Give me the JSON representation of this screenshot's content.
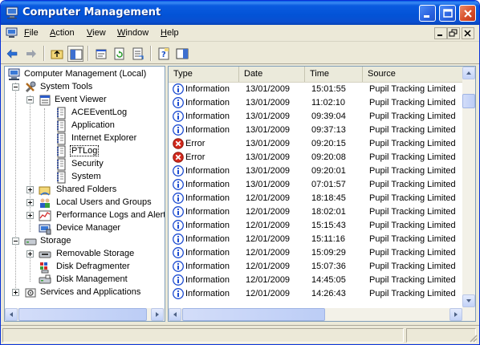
{
  "window": {
    "title": "Computer Management"
  },
  "menubar": {
    "items": [
      {
        "key": "F",
        "rest": "ile"
      },
      {
        "key": "A",
        "rest": "ction"
      },
      {
        "key": "V",
        "rest": "iew"
      },
      {
        "key": "W",
        "rest": "indow"
      },
      {
        "key": "H",
        "rest": "elp"
      }
    ]
  },
  "tree": {
    "items": [
      {
        "label": "Computer Management (Local)",
        "icon": "computer-icon"
      },
      {
        "label": "System Tools",
        "icon": "tools-icon"
      },
      {
        "label": "Event Viewer",
        "icon": "event-viewer-icon"
      },
      {
        "label": "ACEEventLog",
        "icon": "log-icon"
      },
      {
        "label": "Application",
        "icon": "log-icon"
      },
      {
        "label": "Internet Explorer",
        "icon": "log-icon"
      },
      {
        "label": "PTLog",
        "icon": "log-icon",
        "selected": true
      },
      {
        "label": "Security",
        "icon": "log-icon"
      },
      {
        "label": "System",
        "icon": "log-icon"
      },
      {
        "label": "Shared Folders",
        "icon": "shared-folder-icon"
      },
      {
        "label": "Local Users and Groups",
        "icon": "users-icon"
      },
      {
        "label": "Performance Logs and Alerts",
        "icon": "performance-icon"
      },
      {
        "label": "Device Manager",
        "icon": "device-manager-icon"
      },
      {
        "label": "Storage",
        "icon": "storage-icon"
      },
      {
        "label": "Removable Storage",
        "icon": "removable-storage-icon"
      },
      {
        "label": "Disk Defragmenter",
        "icon": "defrag-icon"
      },
      {
        "label": "Disk Management",
        "icon": "disk-icon"
      },
      {
        "label": "Services and Applications",
        "icon": "services-icon"
      }
    ]
  },
  "list": {
    "columns": [
      "Type",
      "Date",
      "Time",
      "Source"
    ],
    "rows": [
      {
        "type": "Information",
        "date": "13/01/2009",
        "time": "15:01:55",
        "source": "Pupil Tracking Limited"
      },
      {
        "type": "Information",
        "date": "13/01/2009",
        "time": "11:02:10",
        "source": "Pupil Tracking Limited"
      },
      {
        "type": "Information",
        "date": "13/01/2009",
        "time": "09:39:04",
        "source": "Pupil Tracking Limited"
      },
      {
        "type": "Information",
        "date": "13/01/2009",
        "time": "09:37:13",
        "source": "Pupil Tracking Limited"
      },
      {
        "type": "Error",
        "date": "13/01/2009",
        "time": "09:20:15",
        "source": "Pupil Tracking Limited"
      },
      {
        "type": "Error",
        "date": "13/01/2009",
        "time": "09:20:08",
        "source": "Pupil Tracking Limited"
      },
      {
        "type": "Information",
        "date": "13/01/2009",
        "time": "09:20:01",
        "source": "Pupil Tracking Limited"
      },
      {
        "type": "Information",
        "date": "13/01/2009",
        "time": "07:01:57",
        "source": "Pupil Tracking Limited"
      },
      {
        "type": "Information",
        "date": "12/01/2009",
        "time": "18:18:45",
        "source": "Pupil Tracking Limited"
      },
      {
        "type": "Information",
        "date": "12/01/2009",
        "time": "18:02:01",
        "source": "Pupil Tracking Limited"
      },
      {
        "type": "Information",
        "date": "12/01/2009",
        "time": "15:15:43",
        "source": "Pupil Tracking Limited"
      },
      {
        "type": "Information",
        "date": "12/01/2009",
        "time": "15:11:16",
        "source": "Pupil Tracking Limited"
      },
      {
        "type": "Information",
        "date": "12/01/2009",
        "time": "15:09:29",
        "source": "Pupil Tracking Limited"
      },
      {
        "type": "Information",
        "date": "12/01/2009",
        "time": "15:07:36",
        "source": "Pupil Tracking Limited"
      },
      {
        "type": "Information",
        "date": "12/01/2009",
        "time": "14:45:05",
        "source": "Pupil Tracking Limited"
      },
      {
        "type": "Information",
        "date": "12/01/2009",
        "time": "14:26:43",
        "source": "Pupil Tracking Limited"
      }
    ]
  },
  "colors": {
    "titlebar": "#0353d6",
    "info_icon": "#1c4bd1",
    "error_icon": "#d3281c",
    "pane_border": "#7f9db9",
    "chrome": "#ece9d8"
  }
}
